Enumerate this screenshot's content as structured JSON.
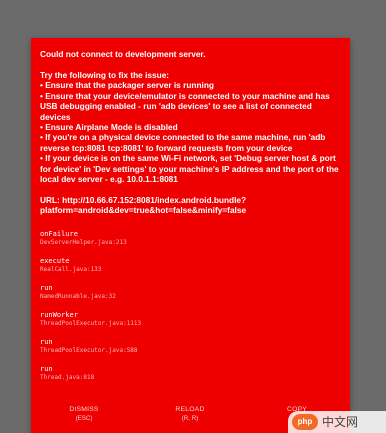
{
  "error": {
    "title": "Could not connect to development server.",
    "intro": "Try the following to fix the issue:",
    "bullets": [
      "• Ensure that the packager server is running",
      "• Ensure that your device/emulator is connected to your machine and has USB debugging enabled - run 'adb devices' to see a list of connected devices",
      "• Ensure Airplane Mode is disabled",
      "• If you're on a physical device connected to the same machine, run 'adb reverse tcp:8081 tcp:8081' to forward requests from your device",
      "• If your device is on the same Wi-Fi network, set 'Debug server host & port for device' in 'Dev settings' to your machine's IP address and the port of the local dev server - e.g. 10.0.1.1:8081"
    ],
    "url": "URL: http://10.66.67.152:8081/index.android.bundle?platform=android&dev=true&hot=false&minify=false"
  },
  "stack": [
    {
      "method": "onFailure",
      "file": "DevServerHelper.java:213"
    },
    {
      "method": "execute",
      "file": "RealCall.java:133"
    },
    {
      "method": "run",
      "file": "NamedRunnable.java:32"
    },
    {
      "method": "runWorker",
      "file": "ThreadPoolExecutor.java:1113"
    },
    {
      "method": "run",
      "file": "ThreadPoolExecutor.java:588"
    },
    {
      "method": "run",
      "file": "Thread.java:818"
    }
  ],
  "buttons": {
    "dismiss": {
      "label": "DISMISS",
      "hint": "(ESC)"
    },
    "reload": {
      "label": "RELOAD",
      "hint": "(R, R)"
    },
    "copy": {
      "label": "COPY"
    }
  },
  "watermark": {
    "logo": "php",
    "text": "中文网"
  },
  "colors": {
    "dialog_background": "#ee0000",
    "backdrop": "#6b6b6b",
    "text": "#ffffff",
    "stack_file_text": "#ffb3b3"
  }
}
